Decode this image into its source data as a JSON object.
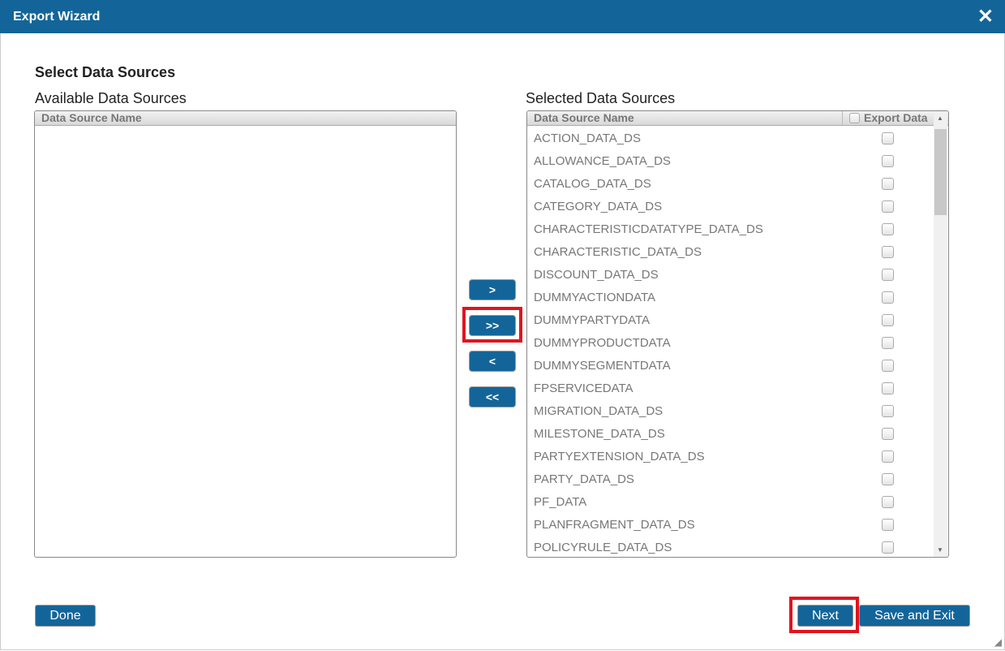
{
  "window": {
    "title": "Export Wizard",
    "close_icon": "close-icon"
  },
  "heading": "Select Data Sources",
  "available": {
    "label": "Available Data Sources",
    "column": "Data Source Name",
    "items": []
  },
  "selected": {
    "label": "Selected Data Sources",
    "column": "Data Source Name",
    "export_column": "Export Data",
    "items": [
      "ACTION_DATA_DS",
      "ALLOWANCE_DATA_DS",
      "CATALOG_DATA_DS",
      "CATEGORY_DATA_DS",
      "CHARACTERISTICDATATYPE_DATA_DS",
      "CHARACTERISTIC_DATA_DS",
      "DISCOUNT_DATA_DS",
      "DUMMYACTIONDATA",
      "DUMMYPARTYDATA",
      "DUMMYPRODUCTDATA",
      "DUMMYSEGMENTDATA",
      "FPSERVICEDATA",
      "MIGRATION_DATA_DS",
      "MILESTONE_DATA_DS",
      "PARTYEXTENSION_DATA_DS",
      "PARTY_DATA_DS",
      "PF_DATA",
      "PLANFRAGMENT_DATA_DS",
      "POLICYRULE_DATA_DS"
    ]
  },
  "move": {
    "add": ">",
    "add_all": ">>",
    "remove": "<",
    "remove_all": "<<"
  },
  "footer": {
    "done": "Done",
    "next": "Next",
    "save_exit": "Save and Exit"
  },
  "colors": {
    "accent": "#136599",
    "highlight": "#e0141e"
  }
}
